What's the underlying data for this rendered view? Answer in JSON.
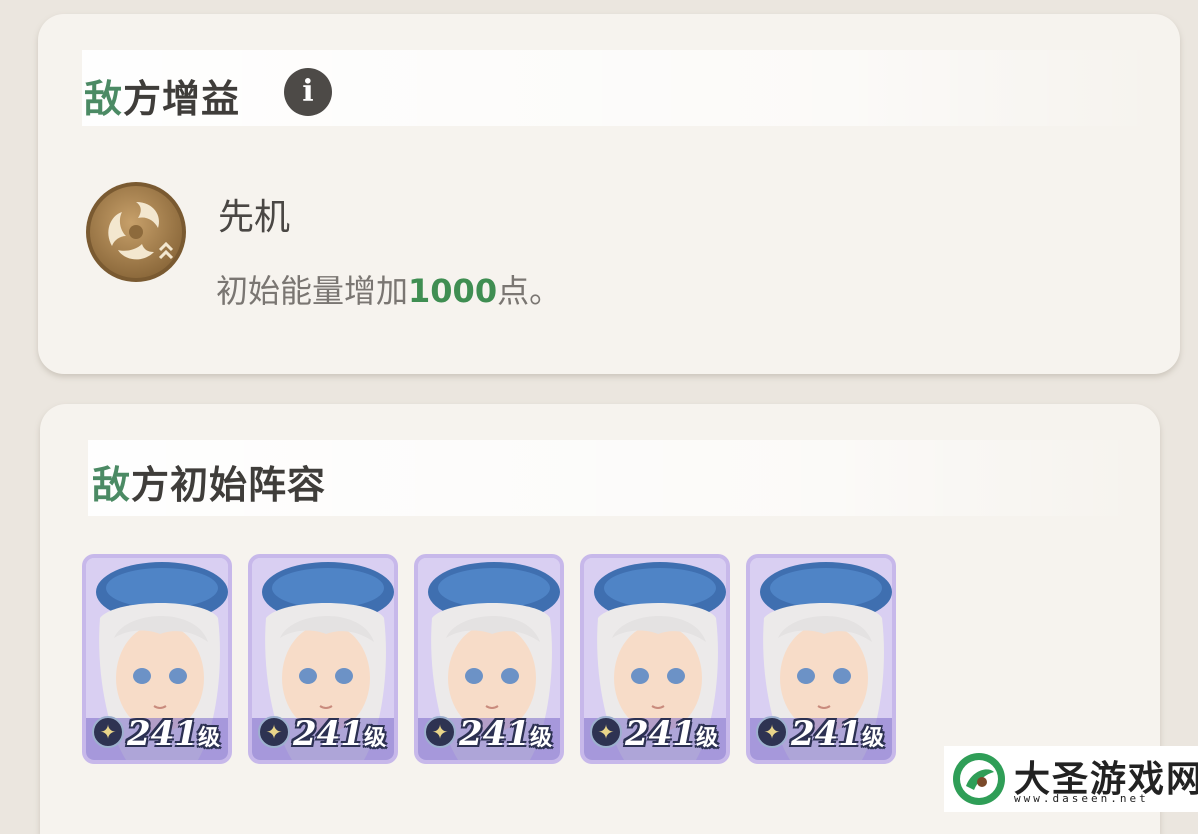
{
  "enemy_buff": {
    "title_accent": "敌",
    "title_rest": "方增益",
    "info_icon": "i",
    "buff": {
      "icon": "wind-swirl-speed-icon",
      "name": "先机",
      "desc_prefix": "初始能量增加",
      "desc_value": "1000",
      "desc_suffix": "点。"
    }
  },
  "enemy_lineup": {
    "title_accent": "敌",
    "title_rest": "方初始阵容",
    "heroes": [
      {
        "level": "241",
        "level_unit": "级"
      },
      {
        "level": "241",
        "level_unit": "级"
      },
      {
        "level": "241",
        "level_unit": "级"
      },
      {
        "level": "241",
        "level_unit": "级"
      },
      {
        "level": "241",
        "level_unit": "级"
      }
    ]
  },
  "watermark": {
    "text": "大圣游戏网",
    "url": "www.daseen.net"
  },
  "colors": {
    "accent_green": "#4b8a64",
    "value_green": "#3f8e52",
    "card_bg": "#f6f3ee",
    "page_bg": "#ebe6df"
  }
}
